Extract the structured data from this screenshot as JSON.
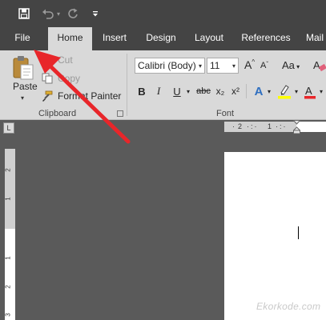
{
  "qat": {
    "save_icon": "save-icon",
    "undo_icon": "undo-icon",
    "redo_icon": "redo-icon",
    "customize_icon": "customize-qat-icon"
  },
  "tabs": [
    {
      "label": "File",
      "active": false
    },
    {
      "label": "Home",
      "active": true
    },
    {
      "label": "Insert",
      "active": false
    },
    {
      "label": "Design",
      "active": false
    },
    {
      "label": "Layout",
      "active": false
    },
    {
      "label": "References",
      "active": false
    },
    {
      "label": "Mail",
      "active": false
    }
  ],
  "clipboard": {
    "paste_label": "Paste",
    "cut_label": "Cut",
    "copy_label": "Copy",
    "format_painter_label": "Format Painter",
    "group_label": "Clipboard"
  },
  "font": {
    "font_name": "Calibri (Body)",
    "font_size": "11",
    "bold": "B",
    "italic": "I",
    "underline": "U",
    "strikethrough": "abc",
    "subscript": "x₂",
    "superscript": "x²",
    "grow": "A",
    "shrink": "A",
    "change_case": "Aa",
    "text_effects": "A",
    "group_label": "Font"
  },
  "ruler": {
    "h_numbers": [
      "2",
      "1"
    ],
    "v_numbers": [
      "2",
      "1",
      "1",
      "2",
      "3"
    ],
    "tab_selector": "L"
  },
  "watermark": "Ekorkode.com",
  "colors": {
    "ribbon_bg": "#d9d9d9",
    "titlebar_bg": "#444444",
    "workspace_bg": "#5a5a5a",
    "arrow_red": "#e8262a"
  }
}
